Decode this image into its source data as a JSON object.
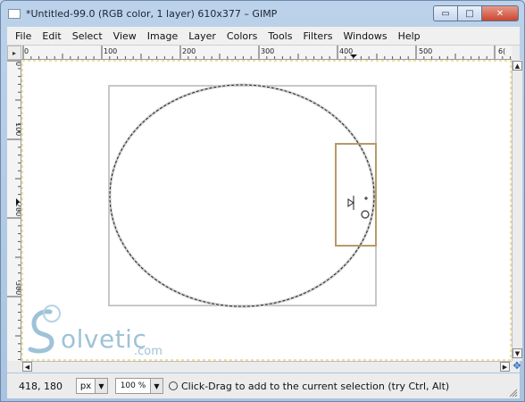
{
  "window": {
    "title": "*Untitled-99.0 (RGB color, 1 layer) 610x377 – GIMP",
    "buttons": {
      "minimize": "▭",
      "maximize": "□",
      "close": "✕"
    }
  },
  "menubar": {
    "items": [
      "File",
      "Edit",
      "Select",
      "View",
      "Image",
      "Layer",
      "Colors",
      "Tools",
      "Filters",
      "Windows",
      "Help"
    ]
  },
  "rulers": {
    "horizontal_labels": [
      "0",
      "100",
      "200",
      "300",
      "400",
      "500",
      "6("
    ],
    "vertical_labels": [
      "0",
      "100",
      "200",
      "300"
    ]
  },
  "statusbar": {
    "coordinates": "418, 180",
    "unit": "px",
    "zoom": "100 %",
    "message": "Click-Drag to add to the current selection (try Ctrl, Alt)"
  },
  "watermark": {
    "brand": "olvetic",
    "suffix": ".com"
  },
  "colors": {
    "selection_box": "#b79a6a",
    "frame": "#c8c8c8",
    "marching_ants": "#222222",
    "watermark": "#9fc2d8"
  }
}
